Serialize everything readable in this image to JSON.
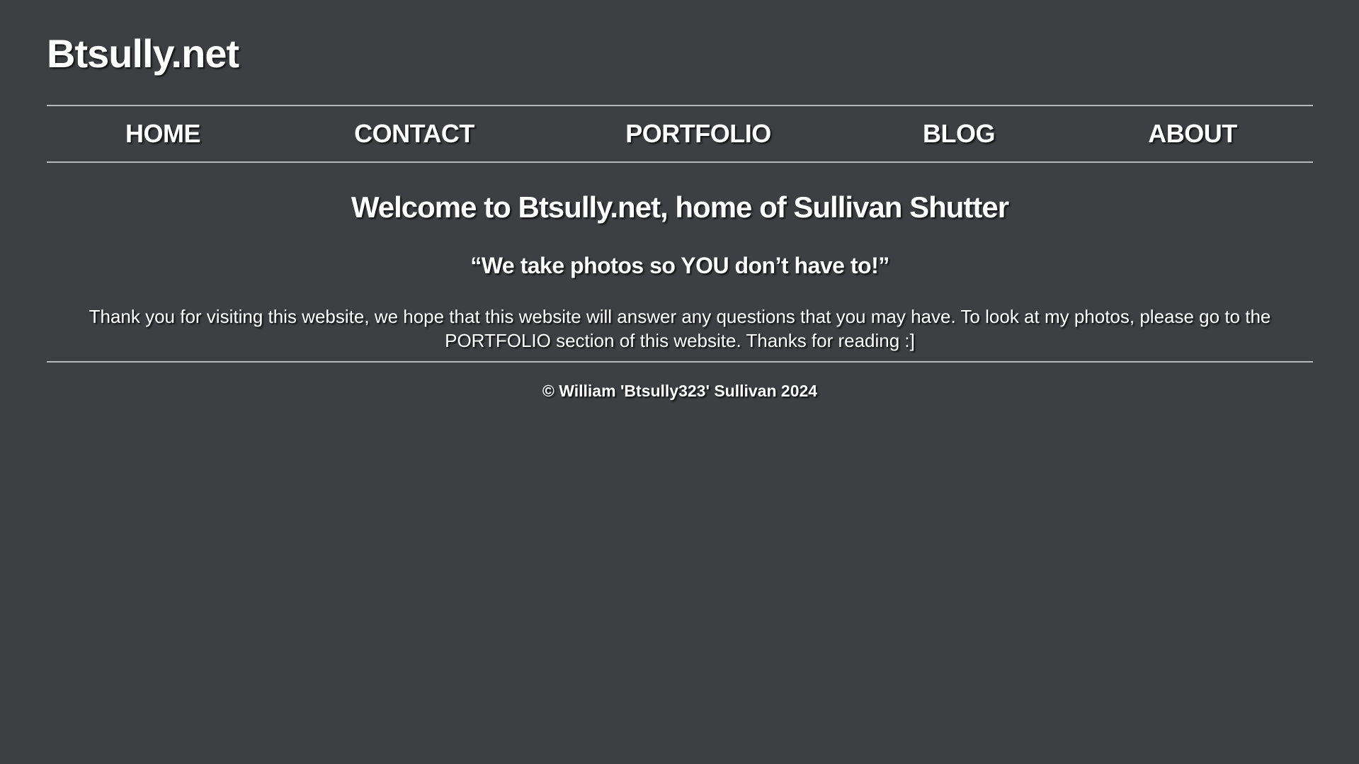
{
  "header": {
    "site_title": "Btsully.net"
  },
  "nav": {
    "items": [
      {
        "label": "HOME"
      },
      {
        "label": "CONTACT"
      },
      {
        "label": "PORTFOLIO"
      },
      {
        "label": "BLOG"
      },
      {
        "label": "ABOUT"
      }
    ]
  },
  "main": {
    "welcome": "Welcome to Btsully.net, home of Sullivan Shutter",
    "tagline": "“We take photos so YOU don’t have to!”",
    "intro": "Thank you for visiting this website, we hope that this website will answer any questions that you may have. To look at my photos, please go to the PORTFOLIO section of this website. Thanks for reading :]"
  },
  "footer": {
    "copyright": "© William 'Btsully323' Sullivan 2024"
  },
  "colors": {
    "background": "#3e3f43",
    "text": "#ffffff",
    "rule": "#b9babd"
  }
}
